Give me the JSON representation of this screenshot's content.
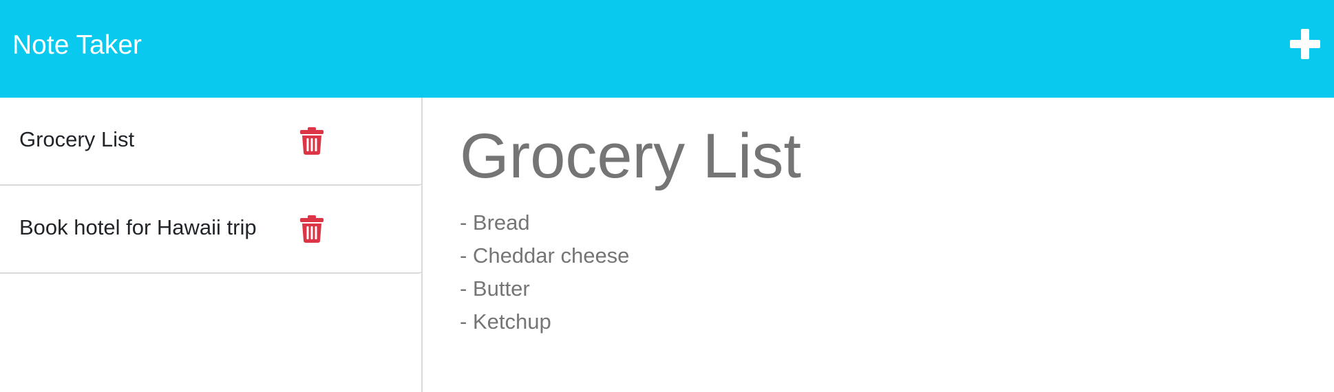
{
  "app": {
    "brand": "Note Taker"
  },
  "toolbar": {
    "new_note_icon": "plus-icon"
  },
  "sidebar": {
    "notes": [
      {
        "title": "Grocery List",
        "delete_icon": "trash-icon"
      },
      {
        "title": "Book hotel for Hawaii trip",
        "delete_icon": "trash-icon"
      }
    ]
  },
  "editor": {
    "title": "Grocery List",
    "lines": [
      "- Bread",
      "- Cheddar cheese",
      "- Butter",
      "- Ketchup"
    ]
  },
  "colors": {
    "navbar": "#0ac9ef",
    "delete": "#dc3545",
    "muted_text": "#757575"
  }
}
